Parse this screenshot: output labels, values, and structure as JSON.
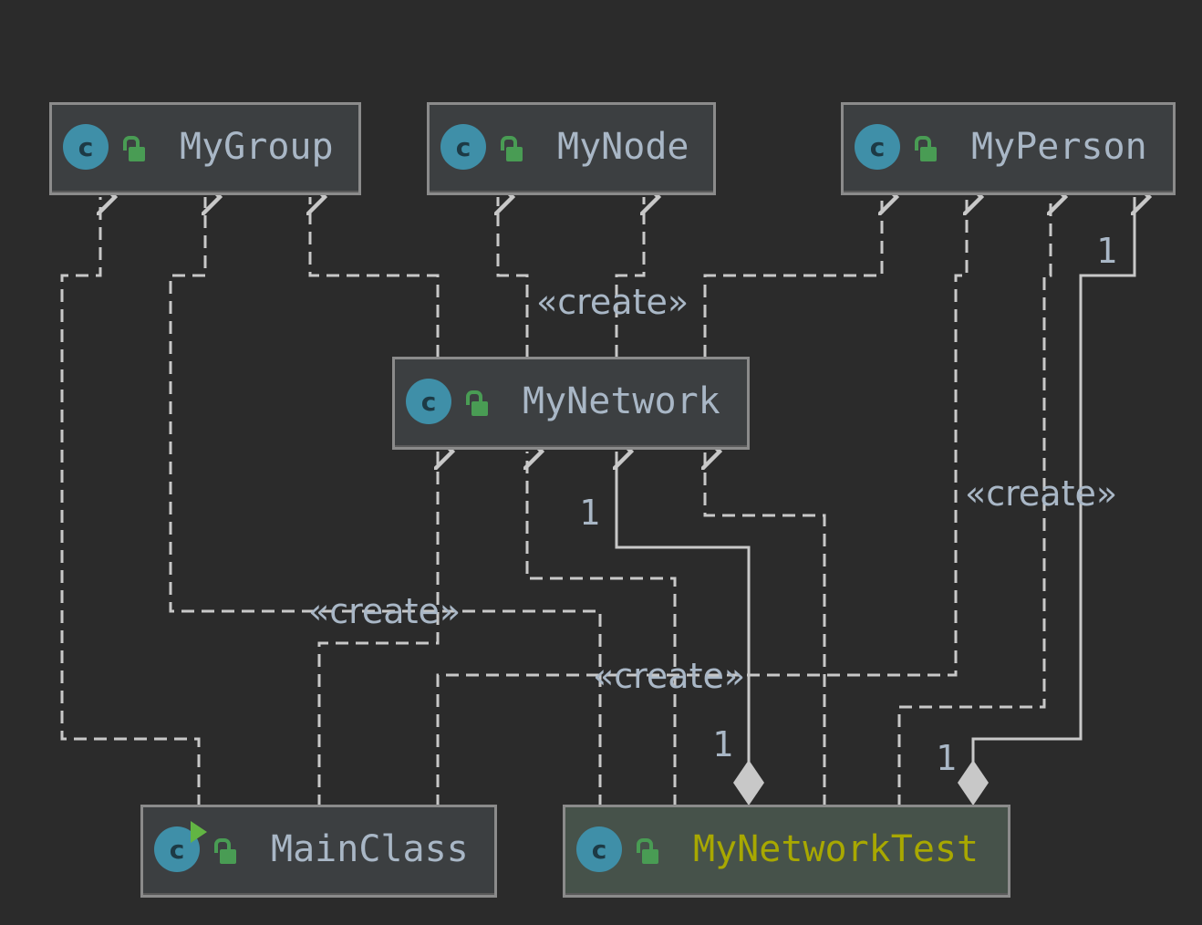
{
  "classes": {
    "mygroup": "MyGroup",
    "mynode": "MyNode",
    "myperson": "MyPerson",
    "mynetwork": "MyNetwork",
    "mainclass": "MainClass",
    "mynetworktest": "MyNetworkTest"
  },
  "class_icon_letter": "c",
  "icons": {
    "class": "class-c-icon",
    "public": "unlocked-padlock-icon",
    "runnable": "run-arrow-icon"
  },
  "edge_labels": {
    "create": "«create»",
    "multiplicity_one": "1"
  },
  "colors": {
    "background": "#2b2b2b",
    "node_fill": "#3c3f41",
    "selected_fill": "#46524a",
    "border": "#8b8b8b",
    "edge": "#c8c8c8",
    "text": "#a9b7c6",
    "selected_text": "#a8a800",
    "class_icon": "#3f8fa8",
    "padlock": "#499c54"
  }
}
